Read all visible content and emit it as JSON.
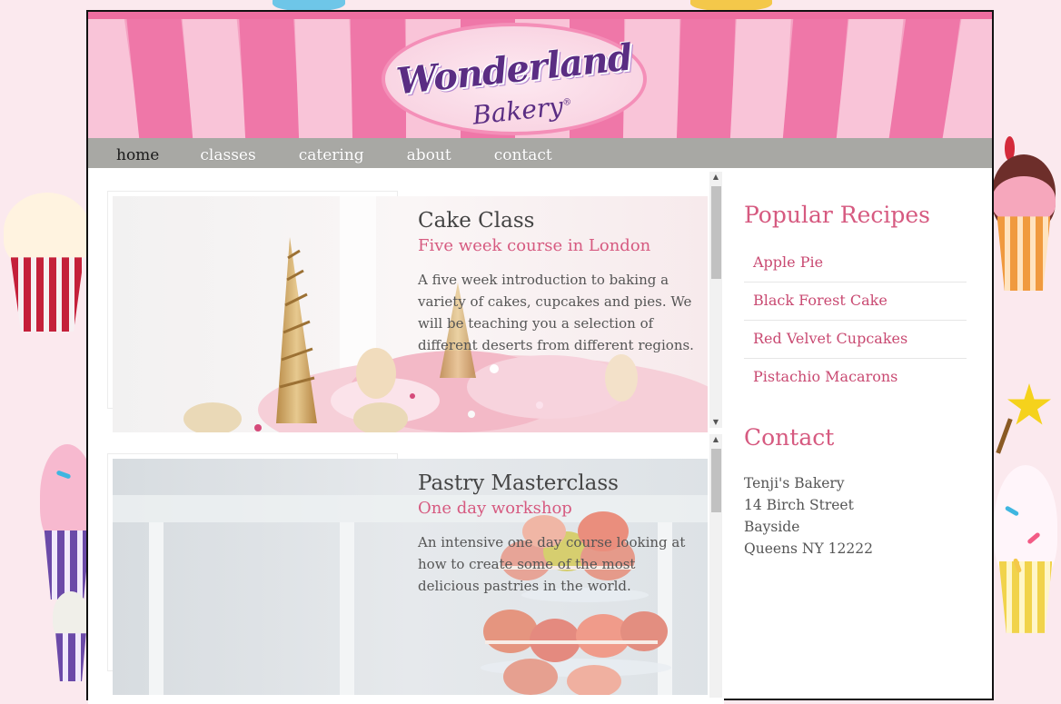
{
  "site": {
    "brand_main": "Wonderland",
    "brand_sub": "Bakery",
    "brand_mark": "®"
  },
  "nav": {
    "items": [
      {
        "label": "home",
        "active": true
      },
      {
        "label": "classes",
        "active": false
      },
      {
        "label": "catering",
        "active": false
      },
      {
        "label": "about",
        "active": false
      },
      {
        "label": "contact",
        "active": false
      }
    ]
  },
  "classes": [
    {
      "title": "Cake Class",
      "subtitle": "Five week course in London",
      "description": "A five week introduction to baking a variety of cakes, cupcakes and pies. We will be teaching you a selection of different deserts from different regions.",
      "photo": "unicorn-cake-photo"
    },
    {
      "title": "Pastry Masterclass",
      "subtitle": "One day workshop",
      "description": "An intensive one day course looking at how to create some of the most delicious pastries in the world.",
      "photo": "macaron-tower-photo"
    }
  ],
  "sidebar": {
    "recipes_heading": "Popular Recipes",
    "recipes": [
      "Apple Pie",
      "Black Forest Cake",
      "Red Velvet Cupcakes",
      "Pistachio Macarons"
    ],
    "contact_heading": "Contact",
    "address": [
      "Tenji's Bakery",
      "14 Birch Street",
      "Bayside",
      "Queens NY 12222"
    ]
  },
  "colors": {
    "accent_pink": "#d65a80",
    "nav_gray": "#a8a8a4",
    "page_bg": "#fbe9ee",
    "awning_pink": "#ef77a8",
    "logo_purple": "#5a2d83"
  },
  "scroll": {
    "card1_position": 0.0,
    "card2_position": 0.0
  }
}
